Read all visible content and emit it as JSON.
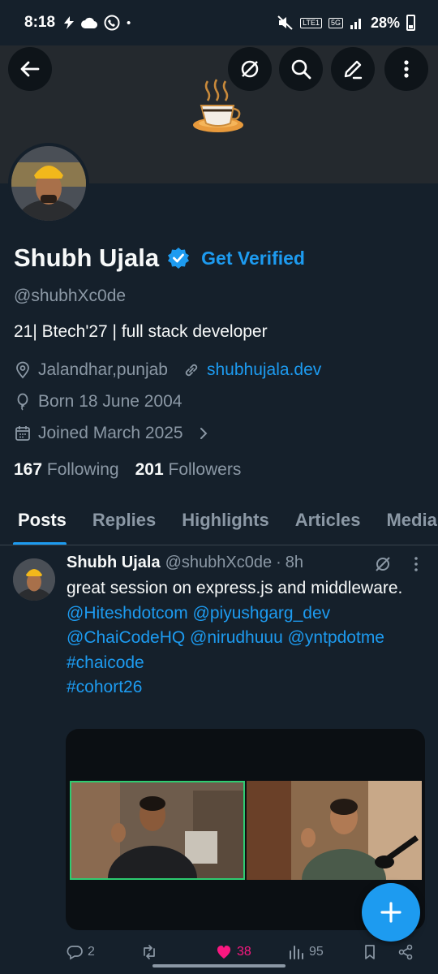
{
  "status_bar": {
    "time": "8:18",
    "network": "5G",
    "lte": "LTE1",
    "battery": "28%"
  },
  "header": {
    "back_icon": "arrow-left-icon",
    "grok_icon": "grok-icon",
    "search_icon": "search-icon",
    "edit_icon": "edit-icon",
    "more_icon": "more-vertical-icon"
  },
  "profile": {
    "display_name": "Shubh Ujala",
    "get_verified": "Get Verified",
    "handle": "@shubhXc0de",
    "bio": "21| Btech'27 | full stack developer",
    "location": "Jalandhar,punjab",
    "website": "shubhujala.dev",
    "born": "Born 18 June 2004",
    "joined": "Joined March 2025",
    "following_count": "167",
    "following_label": "Following",
    "followers_count": "201",
    "followers_label": "Followers"
  },
  "tabs": [
    {
      "label": "Posts",
      "active": true
    },
    {
      "label": "Replies",
      "active": false
    },
    {
      "label": "Highlights",
      "active": false
    },
    {
      "label": "Articles",
      "active": false
    },
    {
      "label": "Media",
      "active": false
    }
  ],
  "post": {
    "name": "Shubh Ujala",
    "handle": "@shubhXc0de",
    "dot": "·",
    "time": "8h",
    "text": "great session on express.js and middleware.",
    "mentions": "@Hiteshdotcom @piyushgarg_dev @ChaiCodeHQ @nirudhuuu @yntpdotme",
    "hashtag1": "#chaicode",
    "hashtag2": "#cohort26",
    "replies": "2",
    "likes": "38",
    "views": "95"
  },
  "colors": {
    "background": "#15202b",
    "accent": "#1d9bf0",
    "like": "#f91880",
    "muted": "#8b98a5"
  }
}
